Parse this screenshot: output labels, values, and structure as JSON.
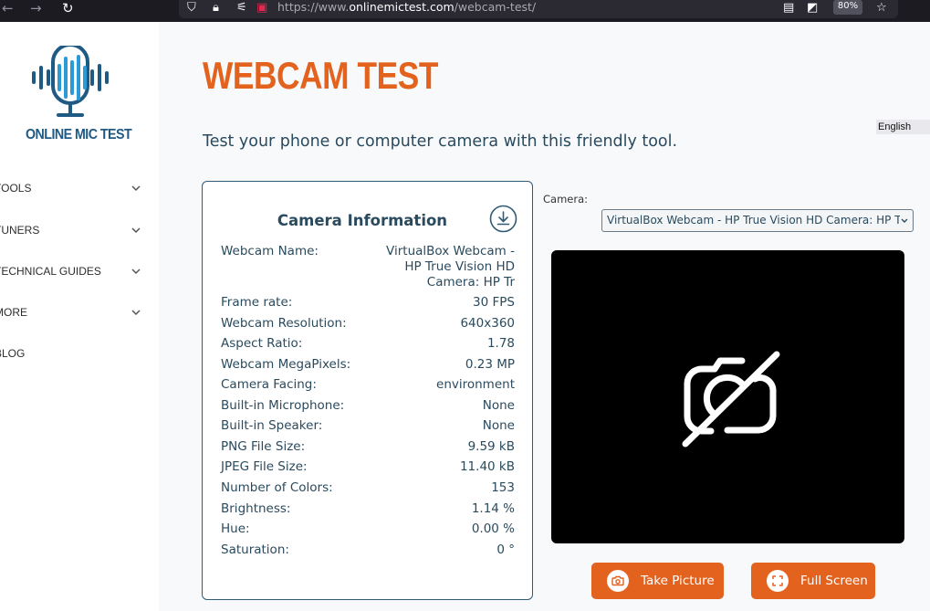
{
  "browser": {
    "url_scheme": "https://www.",
    "url_host": "onlinemictest.com",
    "url_path": "/webcam-test/",
    "zoom": "80%"
  },
  "sidebar": {
    "logo_text": "ONLINE MIC TEST",
    "items": [
      {
        "label": "TOOLS",
        "has_submenu": true
      },
      {
        "label": "TUNERS",
        "has_submenu": true
      },
      {
        "label": "TECHNICAL GUIDES",
        "has_submenu": true
      },
      {
        "label": "MORE",
        "has_submenu": true
      },
      {
        "label": "BLOG",
        "has_submenu": false
      }
    ]
  },
  "main": {
    "title": "WEBCAM TEST",
    "subtitle": "Test your phone or computer camera with this friendly tool.",
    "language": "English"
  },
  "camera_info": {
    "title": "Camera Information",
    "rows": [
      {
        "label": "Webcam Name:",
        "value": "VirtualBox Webcam - HP True Vision HD Camera: HP Tr"
      },
      {
        "label": "Frame rate:",
        "value": "30 FPS"
      },
      {
        "label": "Webcam Resolution:",
        "value": "640x360"
      },
      {
        "label": "Aspect Ratio:",
        "value": "1.78"
      },
      {
        "label": "Webcam MegaPixels:",
        "value": "0.23 MP"
      },
      {
        "label": "Camera Facing:",
        "value": "environment"
      },
      {
        "label": "Built-in Microphone:",
        "value": "None"
      },
      {
        "label": "Built-in Speaker:",
        "value": "None"
      },
      {
        "label": "PNG File Size:",
        "value": "9.59 kB"
      },
      {
        "label": "JPEG File Size:",
        "value": "11.40 kB"
      },
      {
        "label": "Number of Colors:",
        "value": "153"
      },
      {
        "label": "Brightness:",
        "value": "1.14 %"
      },
      {
        "label": "Hue:",
        "value": "0.00 %"
      },
      {
        "label": "Saturation:",
        "value": "0 °"
      }
    ]
  },
  "camera_select": {
    "label": "Camera:",
    "selected": "VirtualBox Webcam - HP True Vision HD Camera: HP Tr"
  },
  "actions": {
    "take_picture": "Take Picture",
    "full_screen": "Full Screen"
  },
  "colors": {
    "accent": "#e3621d",
    "text": "#2a4a5e",
    "logo": "#1f5a85"
  }
}
